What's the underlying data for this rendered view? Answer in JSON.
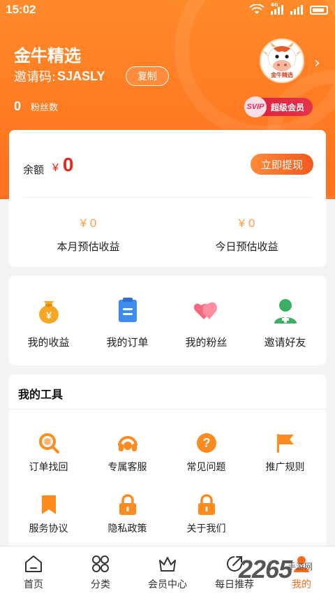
{
  "status_bar": {
    "time": "15:02",
    "network": "4G"
  },
  "profile": {
    "app_title": "金牛精选",
    "invite_label": "邀请码:",
    "invite_code": "SJASLY",
    "copy_label": "复制",
    "fans_count": "0",
    "fans_label": "粉丝数",
    "avatar_caption": "金牛精选",
    "svip_icon_text": "SVIP",
    "svip_label": "超级会员"
  },
  "balance": {
    "label": "余额",
    "currency": "¥",
    "amount": "0",
    "withdraw_label": "立即提现",
    "month_estimate_value": "¥ 0",
    "month_estimate_label": "本月预估收益",
    "today_estimate_value": "¥ 0",
    "today_estimate_label": "今日预估收益"
  },
  "quick_actions": [
    {
      "label": "我的收益",
      "icon": "money-bag-icon"
    },
    {
      "label": "我的订单",
      "icon": "clipboard-icon"
    },
    {
      "label": "我的粉丝",
      "icon": "hearts-icon"
    },
    {
      "label": "邀请好友",
      "icon": "add-user-icon"
    }
  ],
  "tools": {
    "title": "我的工具",
    "items": [
      {
        "label": "订单找回",
        "icon": "search-icon"
      },
      {
        "label": "专属客服",
        "icon": "headset-icon"
      },
      {
        "label": "常见问题",
        "icon": "question-icon"
      },
      {
        "label": "推广规则",
        "icon": "flag-icon"
      },
      {
        "label": "服务协议",
        "icon": "bookmark-icon"
      },
      {
        "label": "隐私政策",
        "icon": "lock-icon"
      },
      {
        "label": "关于我们",
        "icon": "lock-icon"
      }
    ]
  },
  "bottom_nav": [
    {
      "label": "首页",
      "icon": "home-icon",
      "active": false
    },
    {
      "label": "分类",
      "icon": "category-icon",
      "active": false
    },
    {
      "label": "会员中心",
      "icon": "crown-icon",
      "active": false
    },
    {
      "label": "每日推荐",
      "icon": "share-icon",
      "active": false
    },
    {
      "label": "我的",
      "icon": "user-icon",
      "active": true
    }
  ],
  "watermark": {
    "number": "2265",
    "text": "手游网"
  },
  "colors": {
    "brand_orange": "#ff7a22",
    "price_red": "#e8261c",
    "icon_orange": "#ff8a1e"
  }
}
